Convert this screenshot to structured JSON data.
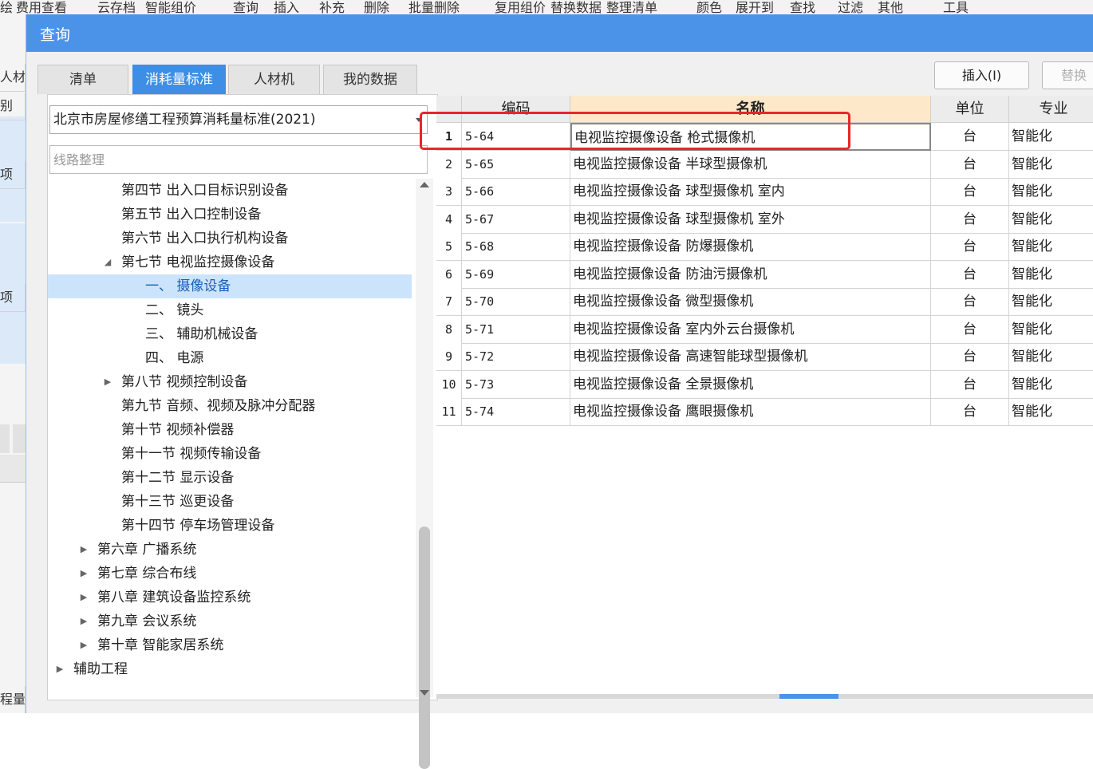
{
  "background": {
    "toolbar_items": [
      "绘",
      "费用查看",
      "云存档",
      "智能组价",
      "查询",
      "插入",
      "补充",
      "删除",
      "批量删除",
      "复用组价",
      "替换数据",
      "整理清单",
      "颜色",
      "展开到",
      "查找",
      "过滤",
      "其他",
      "工具"
    ],
    "left_cells": [
      "人材",
      "别",
      "项",
      "项",
      "程量清"
    ]
  },
  "dialog": {
    "title": "查询",
    "tabs": [
      {
        "label": "清单",
        "active": false
      },
      {
        "label": "消耗量标准",
        "active": true
      },
      {
        "label": "人材机",
        "active": false
      },
      {
        "label": "我的数据",
        "active": false
      }
    ],
    "standard_select": "北京市房屋修缮工程预算消耗量标准(2021)",
    "search": {
      "value": "",
      "placeholder": "线路整理"
    },
    "buttons": {
      "insert": "插入(I)",
      "replace": "替换"
    },
    "tree": [
      {
        "label": "第四节 出入口目标识别设备",
        "arrow": "",
        "level": 2
      },
      {
        "label": "第五节 出入口控制设备",
        "arrow": "",
        "level": 2
      },
      {
        "label": "第六节 出入口执行机构设备",
        "arrow": "",
        "level": 2
      },
      {
        "label": "第七节 电视监控摄像设备",
        "arrow": "◢",
        "level": 2
      },
      {
        "label": "一、 摄像设备",
        "arrow": "",
        "level": 3,
        "selected": true
      },
      {
        "label": "二、 镜头",
        "arrow": "",
        "level": 3
      },
      {
        "label": "三、 辅助机械设备",
        "arrow": "",
        "level": 3
      },
      {
        "label": "四、 电源",
        "arrow": "",
        "level": 3
      },
      {
        "label": "第八节 视频控制设备",
        "arrow": "▶",
        "level": 2
      },
      {
        "label": "第九节 音频、视频及脉冲分配器",
        "arrow": "",
        "level": 2
      },
      {
        "label": "第十节 视频补偿器",
        "arrow": "",
        "level": 2
      },
      {
        "label": "第十一节 视频传输设备",
        "arrow": "",
        "level": 2
      },
      {
        "label": "第十二节 显示设备",
        "arrow": "",
        "level": 2
      },
      {
        "label": "第十三节 巡更设备",
        "arrow": "",
        "level": 2
      },
      {
        "label": "第十四节 停车场管理设备",
        "arrow": "",
        "level": 2
      },
      {
        "label": "第六章 广播系统",
        "arrow": "▶",
        "level": 1
      },
      {
        "label": "第七章 综合布线",
        "arrow": "▶",
        "level": 1
      },
      {
        "label": "第八章 建筑设备监控系统",
        "arrow": "▶",
        "level": 1
      },
      {
        "label": "第九章 会议系统",
        "arrow": "▶",
        "level": 1
      },
      {
        "label": "第十章 智能家居系统",
        "arrow": "▶",
        "level": 1
      },
      {
        "label": "辅助工程",
        "arrow": "▶",
        "level": 0
      }
    ],
    "grid": {
      "columns": [
        "",
        "编码",
        "名称",
        "单位",
        "专业"
      ],
      "rows": [
        {
          "no": "1",
          "code": "5-64",
          "name": "电视监控摄像设备 枪式摄像机",
          "unit": "台",
          "spec": "智能化"
        },
        {
          "no": "2",
          "code": "5-65",
          "name": "电视监控摄像设备 半球型摄像机",
          "unit": "台",
          "spec": "智能化"
        },
        {
          "no": "3",
          "code": "5-66",
          "name": "电视监控摄像设备 球型摄像机 室内",
          "unit": "台",
          "spec": "智能化"
        },
        {
          "no": "4",
          "code": "5-67",
          "name": "电视监控摄像设备 球型摄像机 室外",
          "unit": "台",
          "spec": "智能化"
        },
        {
          "no": "5",
          "code": "5-68",
          "name": "电视监控摄像设备 防爆摄像机",
          "unit": "台",
          "spec": "智能化"
        },
        {
          "no": "6",
          "code": "5-69",
          "name": "电视监控摄像设备 防油污摄像机",
          "unit": "台",
          "spec": "智能化"
        },
        {
          "no": "7",
          "code": "5-70",
          "name": "电视监控摄像设备 微型摄像机",
          "unit": "台",
          "spec": "智能化"
        },
        {
          "no": "8",
          "code": "5-71",
          "name": "电视监控摄像设备 室内外云台摄像机",
          "unit": "台",
          "spec": "智能化"
        },
        {
          "no": "9",
          "code": "5-72",
          "name": "电视监控摄像设备 高速智能球型摄像机",
          "unit": "台",
          "spec": "智能化"
        },
        {
          "no": "10",
          "code": "5-73",
          "name": "电视监控摄像设备 全景摄像机",
          "unit": "台",
          "spec": "智能化"
        },
        {
          "no": "11",
          "code": "5-74",
          "name": "电视监控摄像设备 鹰眼摄像机",
          "unit": "台",
          "spec": "智能化"
        }
      ],
      "selected_row": 0
    },
    "colors": {
      "title_bar": "#4b93e8",
      "tab_active": "#3e8ee6",
      "highlight_box": "#e8262a",
      "tree_selected": "#cce4fb"
    }
  }
}
